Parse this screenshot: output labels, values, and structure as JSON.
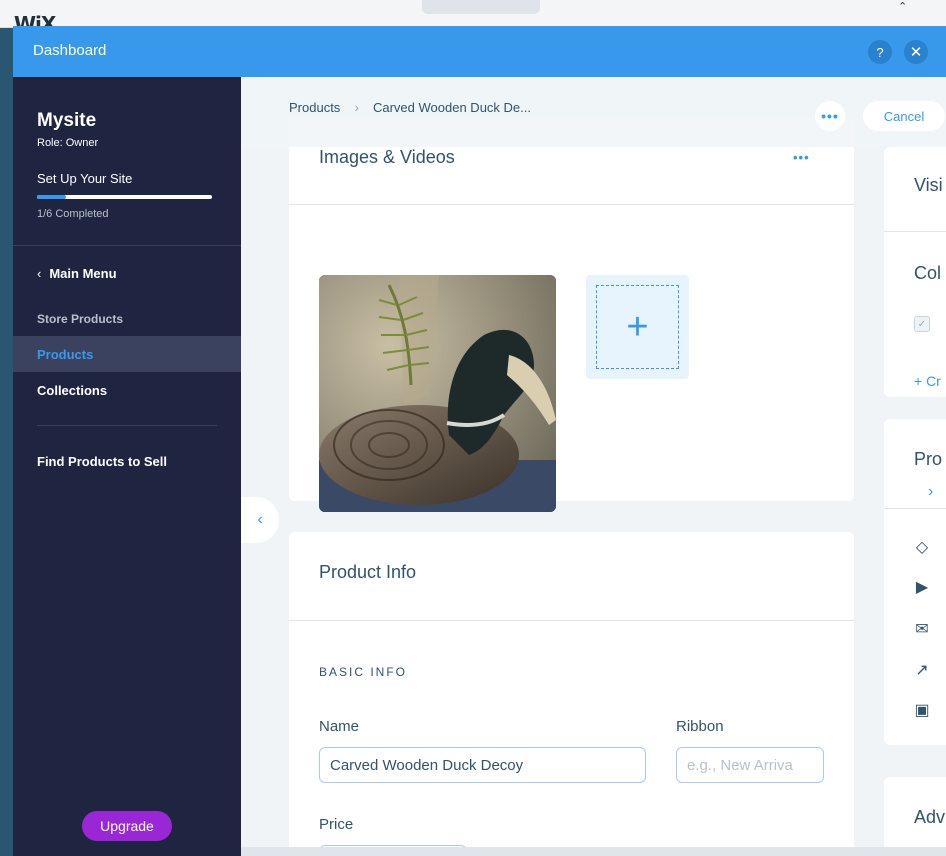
{
  "editor": {
    "logo": "WiX"
  },
  "modal": {
    "title": "Dashboard",
    "help_icon": "?",
    "close_icon": "✕"
  },
  "sidebar": {
    "site_name": "Mysite",
    "role": "Role: Owner",
    "setup_title": "Set Up Your Site",
    "setup_progress": 0.1667,
    "setup_count": "1/6 Completed",
    "main_menu": "Main Menu",
    "section_label": "Store Products",
    "items": [
      {
        "label": "Products",
        "active": true
      },
      {
        "label": "Collections",
        "active": false
      },
      {
        "label": "Find Products to Sell",
        "active": false
      }
    ],
    "upgrade": "Upgrade"
  },
  "header": {
    "breadcrumb": [
      "Products",
      "Carved Wooden Duck De..."
    ],
    "more_icon": "•••",
    "cancel": "Cancel"
  },
  "images_card": {
    "title": "Images & Videos",
    "more_icon": "•••",
    "add_icon": "+"
  },
  "product_info": {
    "title": "Product Info",
    "basic_label": "BASIC INFO",
    "name_label": "Name",
    "name_value": "Carved Wooden Duck Decoy",
    "ribbon_label": "Ribbon",
    "ribbon_placeholder": "e.g., New Arriva",
    "price_label": "Price"
  },
  "right_cards": {
    "visibility_title": "Visi",
    "collections_title": "Col",
    "create_link": "+ Cr",
    "promote_title": "Pro",
    "advanced_title": "Adv"
  },
  "colors": {
    "accent": "#3899ec",
    "sidebar": "#1f2540",
    "upgrade": "#9a27d5"
  }
}
